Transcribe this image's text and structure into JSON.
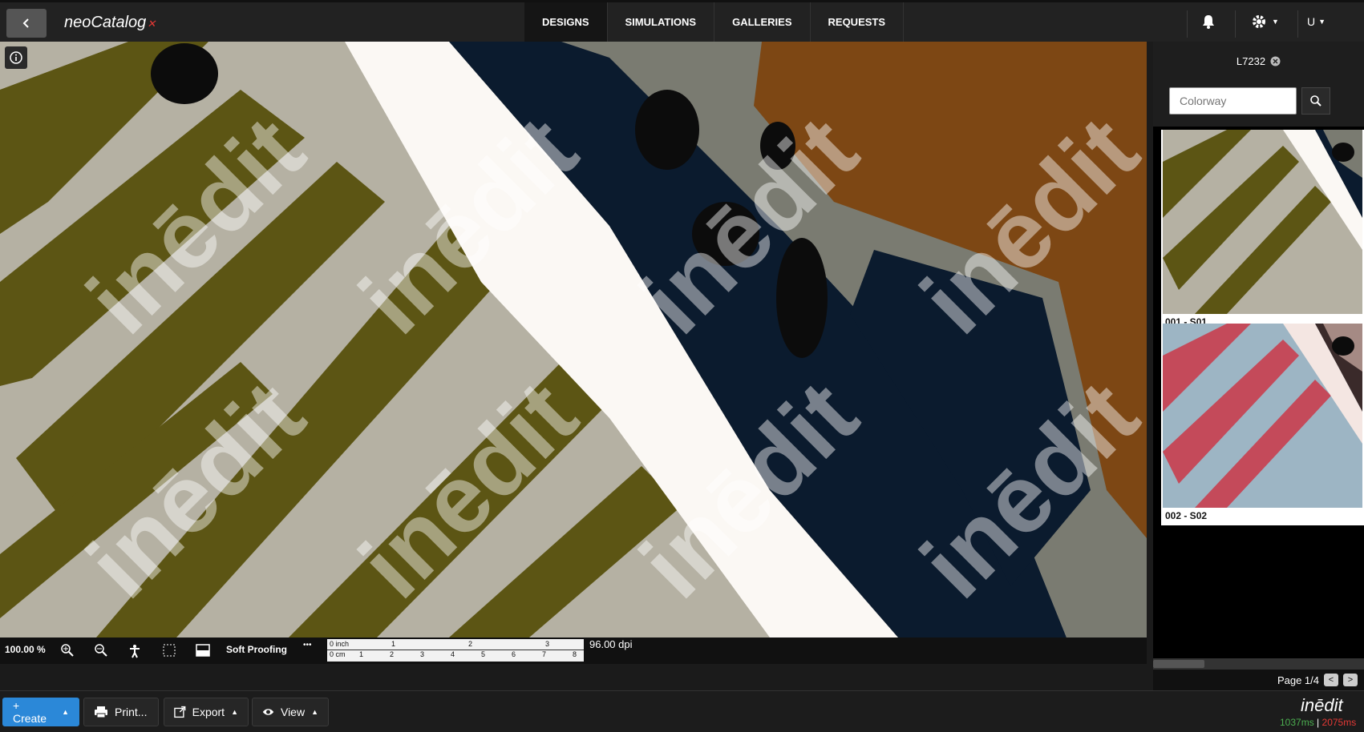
{
  "app": {
    "brand": "neoCatalog",
    "brand_accent_color": "#e53935"
  },
  "nav": {
    "tabs": [
      {
        "label": "DESIGNS",
        "active": true
      },
      {
        "label": "SIMULATIONS",
        "active": false
      },
      {
        "label": "GALLERIES",
        "active": false
      },
      {
        "label": "REQUESTS",
        "active": false
      }
    ]
  },
  "header": {
    "user_initial": "U"
  },
  "canvas": {
    "watermark": "inēdit"
  },
  "status": {
    "zoom": "100.00 %",
    "proofing": "Soft Proofing",
    "more": "•••",
    "ruler_inch": "0 inch",
    "ruler_cm": "0 cm",
    "ruler_inch_ticks": [
      "1",
      "2",
      "3"
    ],
    "ruler_cm_ticks": [
      "1",
      "2",
      "3",
      "4",
      "5",
      "6",
      "7",
      "8"
    ],
    "dpi": "96.00 dpi"
  },
  "sidebar": {
    "design_code": "L7232",
    "search_placeholder": "Colorway",
    "colorways": [
      {
        "label": "001 - S01"
      },
      {
        "label": "002 - S02"
      }
    ],
    "page": "Page 1/4",
    "prev": "<",
    "next": ">"
  },
  "toolbar": {
    "create": "+ Create",
    "print": "Print...",
    "export": "Export",
    "view": "View"
  },
  "footer": {
    "logo": "inēdit",
    "time_1": "1037ms",
    "time_sep": "|",
    "time_2": "2075ms"
  },
  "colors": {
    "accent": "#2b88d8",
    "ok": "#4caf50",
    "warn": "#e53935"
  }
}
